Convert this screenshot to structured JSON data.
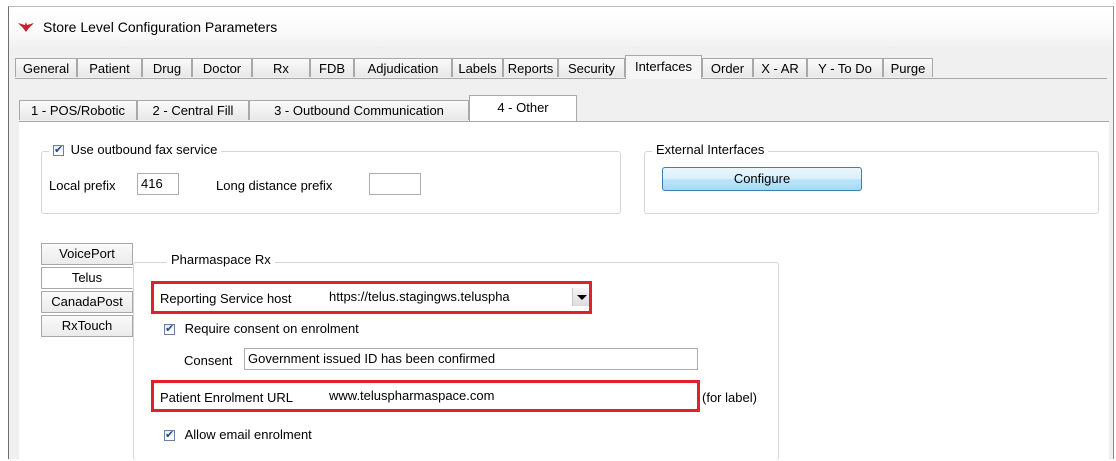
{
  "window": {
    "title": "Store Level Configuration Parameters"
  },
  "main_tabs": [
    {
      "label": "General",
      "active": false
    },
    {
      "label": "Patient",
      "active": false
    },
    {
      "label": "Drug",
      "active": false
    },
    {
      "label": "Doctor",
      "active": false
    },
    {
      "label": "Rx",
      "active": false
    },
    {
      "label": "FDB",
      "active": false
    },
    {
      "label": "Adjudication",
      "active": false
    },
    {
      "label": "Labels",
      "active": false
    },
    {
      "label": "Reports",
      "active": false
    },
    {
      "label": "Security",
      "active": false
    },
    {
      "label": "Interfaces",
      "active": true
    },
    {
      "label": "Order",
      "active": false
    },
    {
      "label": "X - AR",
      "active": false
    },
    {
      "label": "Y - To Do",
      "active": false
    },
    {
      "label": "Purge",
      "active": false
    }
  ],
  "sub_tabs": [
    {
      "label": "1 - POS/Robotic",
      "active": false
    },
    {
      "label": "2 - Central Fill",
      "active": false
    },
    {
      "label": "3 - Outbound Communication",
      "active": false
    },
    {
      "label": "4 - Other",
      "active": true
    }
  ],
  "fax": {
    "checkbox_label": "Use outbound fax service",
    "checked": true,
    "local_prefix_label": "Local prefix",
    "local_prefix_value": "416",
    "long_distance_label": "Long distance prefix",
    "long_distance_value": ""
  },
  "external": {
    "legend": "External Interfaces",
    "configure_label": "Configure"
  },
  "side_tabs": [
    {
      "label": "VoicePort",
      "active": false
    },
    {
      "label": "Telus",
      "active": true
    },
    {
      "label": "CanadaPost",
      "active": false
    },
    {
      "label": "RxTouch",
      "active": false
    }
  ],
  "pharmaspace": {
    "legend": "Pharmaspace Rx",
    "host_label": "Reporting Service host",
    "host_value": "https://telus.stagingws.teluspha",
    "consent_checkbox_label": "Require consent on enrolment",
    "consent_checked": true,
    "consent_label": "Consent",
    "consent_value": "Government issued ID has been confirmed",
    "enrolment_label": "Patient Enrolment URL",
    "enrolment_value": "www.teluspharmaspace.com",
    "for_label": "(for label)",
    "email_checkbox_label": "Allow email enrolment",
    "email_checked": true
  },
  "colors": {
    "highlight": "#e0202a",
    "button_blue": "#3c7fb1"
  }
}
